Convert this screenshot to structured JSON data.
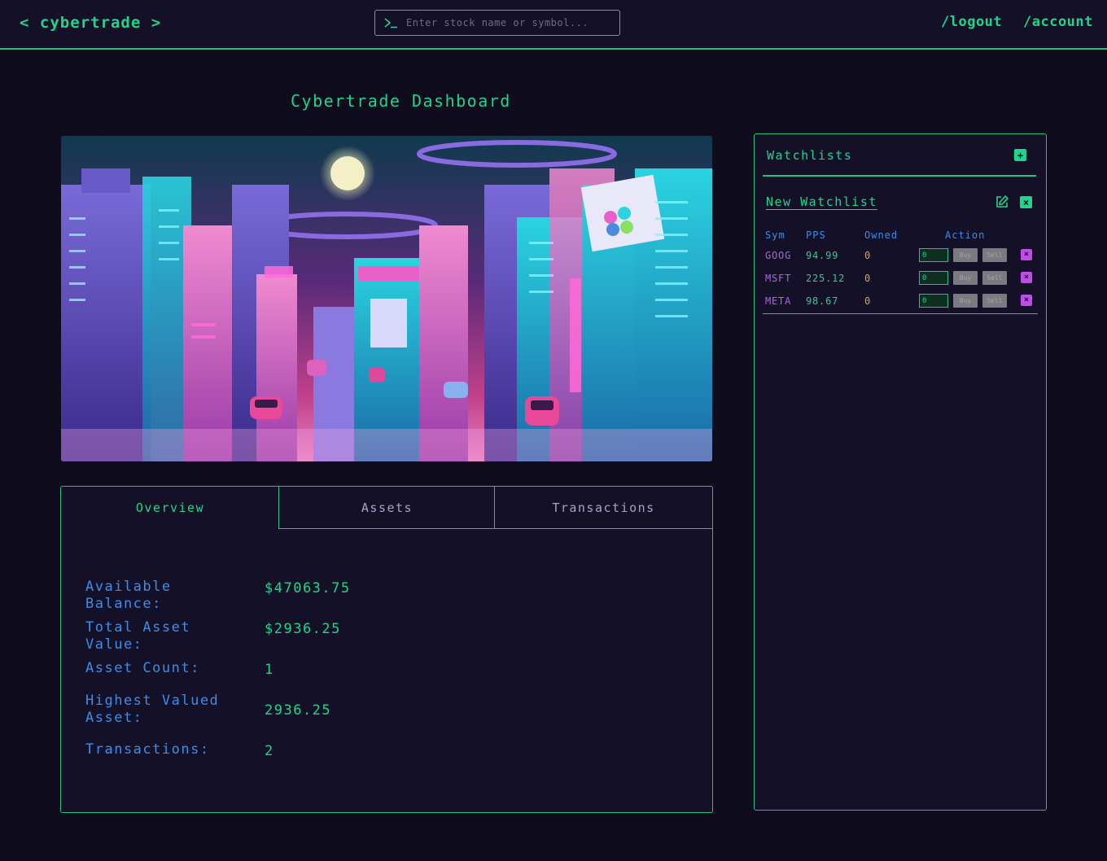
{
  "header": {
    "brand": "< cybertrade >",
    "search_placeholder": "Enter stock name or symbol...",
    "logout": "/logout",
    "account": "/account"
  },
  "page": {
    "title": "Cybertrade Dashboard"
  },
  "tabs": [
    {
      "label": "Overview",
      "active": true
    },
    {
      "label": "Assets",
      "active": false
    },
    {
      "label": "Transactions",
      "active": false
    }
  ],
  "overview": [
    {
      "label": "Available Balance:",
      "value": "$47063.75"
    },
    {
      "label": "Total Asset Value:",
      "value": "$2936.25"
    },
    {
      "label": "Asset Count:",
      "value": "1"
    },
    {
      "label": "Highest Valued Asset:",
      "value": "2936.25"
    },
    {
      "label": "Transactions:",
      "value": "2"
    }
  ],
  "watchlists": {
    "title": "Watchlists",
    "add_icon": "+",
    "list_name": "New Watchlist",
    "delete_icon": "×",
    "columns": {
      "sym": "Sym",
      "pps": "PPS",
      "owned": "Owned",
      "action": "Action"
    },
    "rows": [
      {
        "sym": "GOOG",
        "pps": "94.99",
        "owned": "0",
        "qty": "0",
        "buy": "Buy",
        "sell": "Sell",
        "remove": "×"
      },
      {
        "sym": "MSFT",
        "pps": "225.12",
        "owned": "0",
        "qty": "0",
        "buy": "Buy",
        "sell": "Sell",
        "remove": "×"
      },
      {
        "sym": "META",
        "pps": "98.67",
        "owned": "0",
        "qty": "0",
        "buy": "Buy",
        "sell": "Sell",
        "remove": "×"
      }
    ]
  },
  "colors": {
    "accent": "#1fd58a",
    "label_blue": "#3b8ee6",
    "symbol_purple": "#b261e8",
    "owned_orange": "#e0a532",
    "background": "#0f0c1e"
  }
}
